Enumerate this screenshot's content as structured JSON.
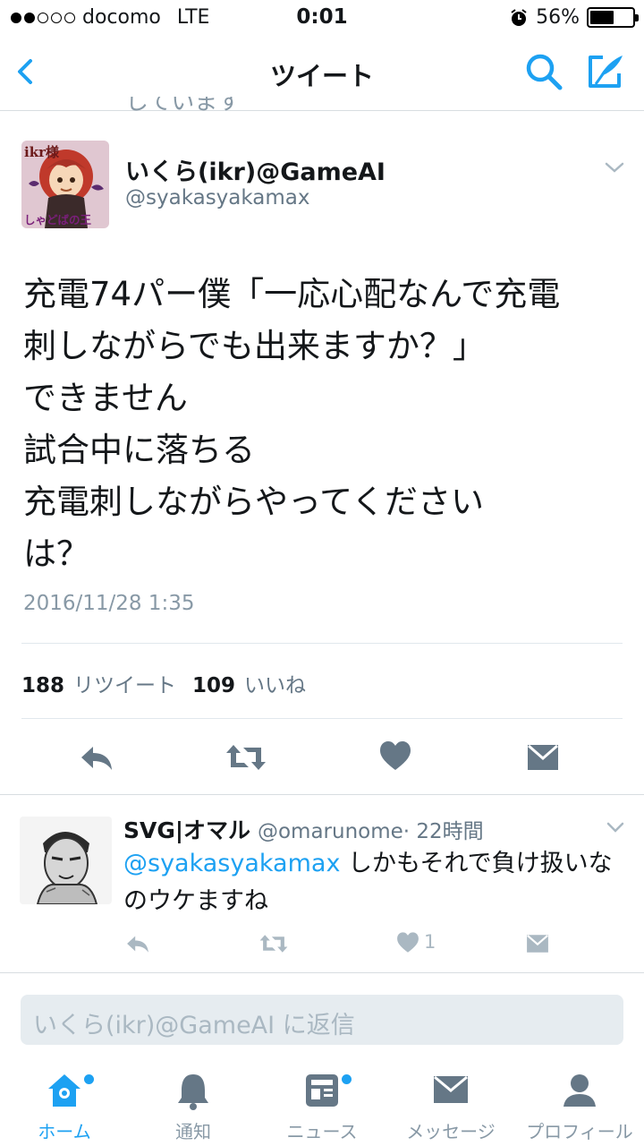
{
  "status_bar": {
    "carrier": "docomo",
    "network": "LTE",
    "time": "0:01",
    "battery": "56%",
    "battery_level": 0.56
  },
  "nav": {
    "title": "ツイート",
    "peek_text": "しています"
  },
  "tweet": {
    "avatar_text_top": "ikr様",
    "avatar_text_bottom": "しゃどばの王",
    "name": "いくら(ikr)@GameAI",
    "handle": "@syakasyakamax",
    "lines": [
      "充電74パー僕「一応心配なんで充電",
      "刺しながらでも出来ますか？」",
      "できません",
      "試合中に落ちる",
      "充電刺しながらやってください",
      "は？"
    ],
    "date": "2016/11/28 1:35",
    "retweets": "188",
    "retweets_label": "リツイート",
    "likes": "109",
    "likes_label": "いいね"
  },
  "reply": {
    "name": "SVG|オマル",
    "handle": "@omarunome",
    "time": "· 22時間",
    "mention": "@syakasyakamax",
    "text": " しかもそれで負け扱いなのウケますね",
    "like_count": "1"
  },
  "reply_box": {
    "placeholder": "いくら(ikr)@GameAI に返信"
  },
  "tabs": [
    {
      "label": "ホーム",
      "icon": "home-icon"
    },
    {
      "label": "通知",
      "icon": "bell-icon"
    },
    {
      "label": "ニュース",
      "icon": "news-icon"
    },
    {
      "label": "メッセージ",
      "icon": "mail-icon"
    },
    {
      "label": "プロフィール",
      "icon": "profile-icon"
    }
  ],
  "colors": {
    "accent": "#1da1f2",
    "icon_gray": "#657786",
    "muted": "#8899a6"
  }
}
